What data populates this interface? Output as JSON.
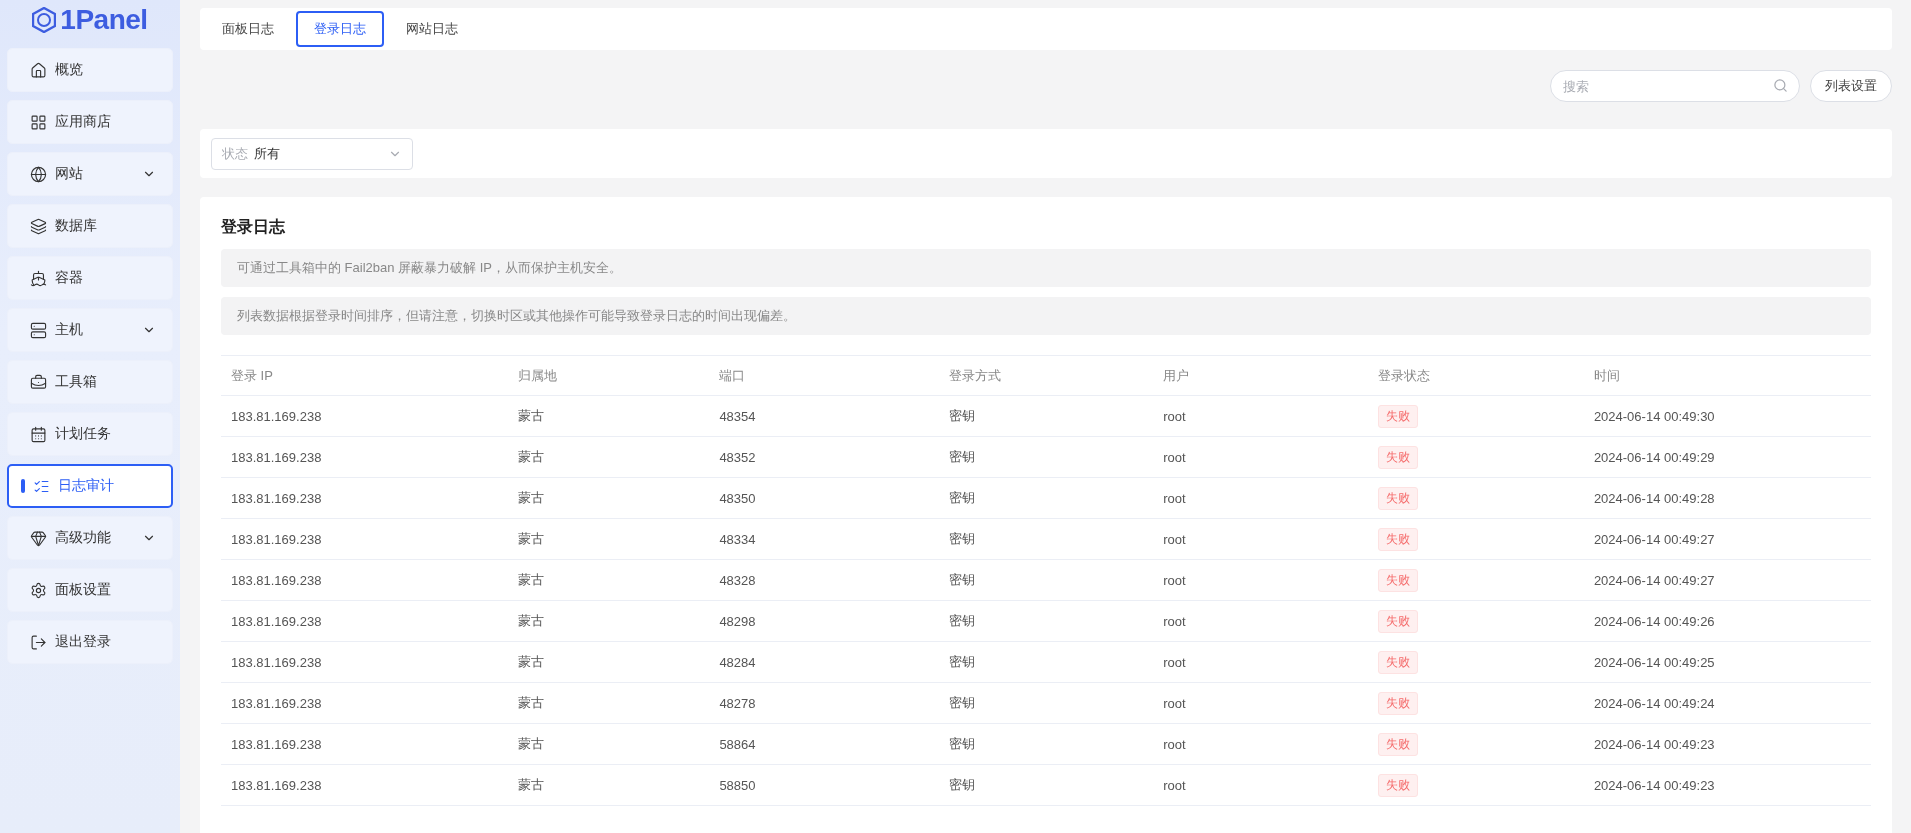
{
  "logo": {
    "text": "1Panel"
  },
  "sidebar": {
    "items": [
      {
        "label": "概览",
        "selected": false,
        "expandable": false
      },
      {
        "label": "应用商店",
        "selected": false,
        "expandable": false
      },
      {
        "label": "网站",
        "selected": false,
        "expandable": true
      },
      {
        "label": "数据库",
        "selected": false,
        "expandable": false
      },
      {
        "label": "容器",
        "selected": false,
        "expandable": false
      },
      {
        "label": "主机",
        "selected": false,
        "expandable": true
      },
      {
        "label": "工具箱",
        "selected": false,
        "expandable": false
      },
      {
        "label": "计划任务",
        "selected": false,
        "expandable": false
      },
      {
        "label": "日志审计",
        "selected": true,
        "expandable": false
      },
      {
        "label": "高级功能",
        "selected": false,
        "expandable": true
      },
      {
        "label": "面板设置",
        "selected": false,
        "expandable": false
      },
      {
        "label": "退出登录",
        "selected": false,
        "expandable": false
      }
    ]
  },
  "tabs": [
    {
      "label": "面板日志",
      "selected": false
    },
    {
      "label": "登录日志",
      "selected": true
    },
    {
      "label": "网站日志",
      "selected": false
    }
  ],
  "search": {
    "placeholder": "搜索"
  },
  "list_settings_button": "列表设置",
  "filter": {
    "label": "状态",
    "value": "所有"
  },
  "card": {
    "title": "登录日志",
    "notices": [
      "可通过工具箱中的 Fail2ban 屏蔽暴力破解 IP，从而保护主机安全。",
      "列表数据根据登录时间排序，但请注意，切换时区或其他操作可能导致登录日志的时间出现偏差。"
    ]
  },
  "table": {
    "columns": [
      "登录 IP",
      "归属地",
      "端口",
      "登录方式",
      "用户",
      "登录状态",
      "时间"
    ],
    "rows": [
      {
        "ip": "183.81.169.238",
        "location": "蒙古",
        "port": "48354",
        "method": "密钥",
        "user": "root",
        "status": {
          "text": "失败",
          "kind": "failure"
        },
        "time": "2024-06-14 00:49:30"
      },
      {
        "ip": "183.81.169.238",
        "location": "蒙古",
        "port": "48352",
        "method": "密钥",
        "user": "root",
        "status": {
          "text": "失败",
          "kind": "failure"
        },
        "time": "2024-06-14 00:49:29"
      },
      {
        "ip": "183.81.169.238",
        "location": "蒙古",
        "port": "48350",
        "method": "密钥",
        "user": "root",
        "status": {
          "text": "失败",
          "kind": "failure"
        },
        "time": "2024-06-14 00:49:28"
      },
      {
        "ip": "183.81.169.238",
        "location": "蒙古",
        "port": "48334",
        "method": "密钥",
        "user": "root",
        "status": {
          "text": "失败",
          "kind": "failure"
        },
        "time": "2024-06-14 00:49:27"
      },
      {
        "ip": "183.81.169.238",
        "location": "蒙古",
        "port": "48328",
        "method": "密钥",
        "user": "root",
        "status": {
          "text": "失败",
          "kind": "failure"
        },
        "time": "2024-06-14 00:49:27"
      },
      {
        "ip": "183.81.169.238",
        "location": "蒙古",
        "port": "48298",
        "method": "密钥",
        "user": "root",
        "status": {
          "text": "失败",
          "kind": "failure"
        },
        "time": "2024-06-14 00:49:26"
      },
      {
        "ip": "183.81.169.238",
        "location": "蒙古",
        "port": "48284",
        "method": "密钥",
        "user": "root",
        "status": {
          "text": "失败",
          "kind": "failure"
        },
        "time": "2024-06-14 00:49:25"
      },
      {
        "ip": "183.81.169.238",
        "location": "蒙古",
        "port": "48278",
        "method": "密钥",
        "user": "root",
        "status": {
          "text": "失败",
          "kind": "failure"
        },
        "time": "2024-06-14 00:49:24"
      },
      {
        "ip": "183.81.169.238",
        "location": "蒙古",
        "port": "58864",
        "method": "密钥",
        "user": "root",
        "status": {
          "text": "失败",
          "kind": "failure"
        },
        "time": "2024-06-14 00:49:23"
      },
      {
        "ip": "183.81.169.238",
        "location": "蒙古",
        "port": "58850",
        "method": "密钥",
        "user": "root",
        "status": {
          "text": "失败",
          "kind": "failure"
        },
        "time": "2024-06-14 00:49:23"
      }
    ]
  }
}
